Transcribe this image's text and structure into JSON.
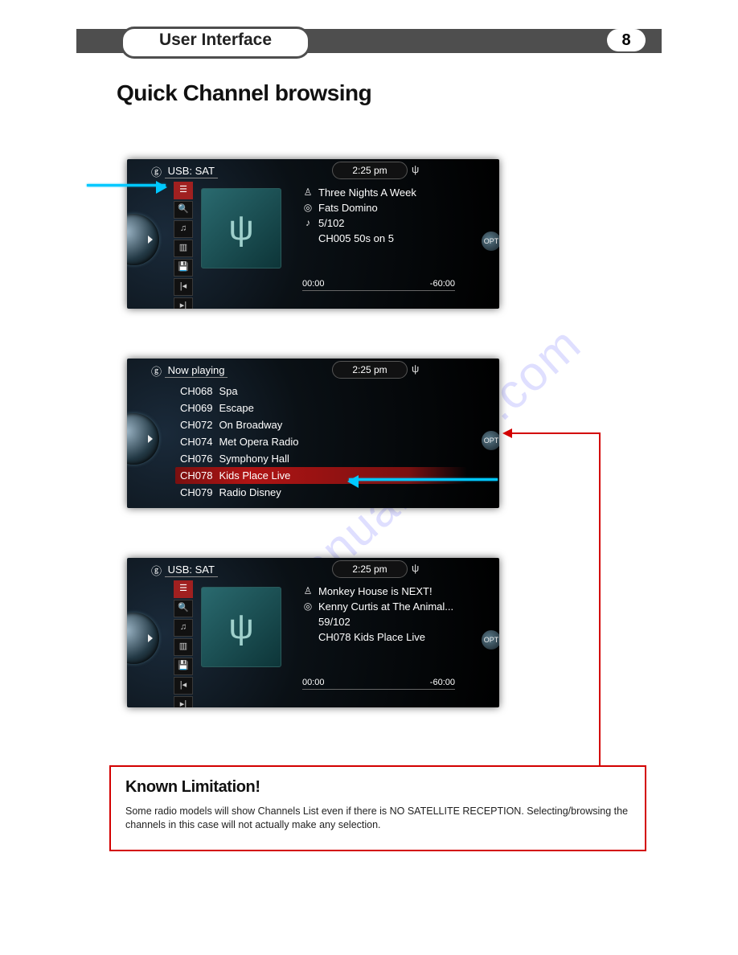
{
  "header": {
    "section": "User Interface",
    "page_number": "8"
  },
  "title": "Quick Channel browsing",
  "watermark": "manualshive.com",
  "clock": "2:25 pm",
  "screen1": {
    "source": "USB: SAT",
    "song": "Three Nights A Week",
    "artist": "Fats Domino",
    "track_pos": "5/102",
    "channel": "CH005  50s on 5",
    "time_start": "00:00",
    "time_end": "-60:00"
  },
  "screen2": {
    "source": "Now playing",
    "channels": [
      {
        "ch": "CH068",
        "name": "Spa"
      },
      {
        "ch": "CH069",
        "name": "Escape"
      },
      {
        "ch": "CH072",
        "name": "On Broadway"
      },
      {
        "ch": "CH074",
        "name": "Met Opera Radio"
      },
      {
        "ch": "CH076",
        "name": "Symphony Hall"
      },
      {
        "ch": "CH078",
        "name": "Kids Place Live"
      },
      {
        "ch": "CH079",
        "name": "Radio Disney"
      }
    ],
    "highlight_index": 5
  },
  "screen3": {
    "source": "USB: SAT",
    "song": "Monkey House is NEXT!",
    "artist": "Kenny Curtis at The Animal...",
    "track_pos": "59/102",
    "channel": "CH078  Kids Place Live",
    "time_start": "00:00",
    "time_end": "-60:00"
  },
  "callout": {
    "heading": "Known Limitation!",
    "body": "Some radio models will show Channels List even if there is NO SATELLITE RECEPTION. Selecting/browsing the channels in this case will not actually make any selection."
  },
  "opt_label": "OPT"
}
